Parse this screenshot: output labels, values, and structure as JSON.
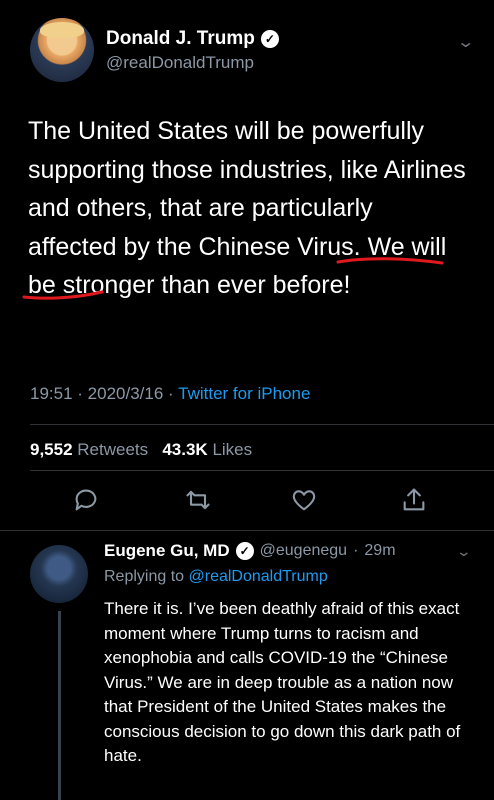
{
  "tweet": {
    "display_name": "Donald J. Trump",
    "handle": "@realDonaldTrump",
    "text_part1": "The United States will be powerfully supporting those industries, like Airlines and others, that are particularly affected by the Chinese Virus. We will be stronger than ever before!",
    "time": "19:51",
    "date": "2020/3/16",
    "source": "Twitter for iPhone",
    "retweets_count": "9,552",
    "retweets_label": "Retweets",
    "likes_count": "43.3K",
    "likes_label": "Likes",
    "underline_color": "#e0191f"
  },
  "reply": {
    "display_name": "Eugene Gu, MD",
    "handle": "@eugenegu",
    "time": "29m",
    "replying_prefix": "Replying to",
    "replying_to": "@realDonaldTrump",
    "text": "There it is. I’ve been deathly afraid of this exact moment where Trump turns to racism and xenophobia and calls COVID-19 the “Chinese Virus.” We are in deep trouble as a nation now that President of the United States makes the conscious decision to go down this dark path of hate."
  },
  "icons": [
    "verified-icon",
    "chevron-down-icon",
    "reply-icon",
    "retweet-icon",
    "like-icon",
    "share-icon"
  ],
  "colors": {
    "background": "#000000",
    "link": "#1d9bf0",
    "secondary": "#8b98a5"
  }
}
